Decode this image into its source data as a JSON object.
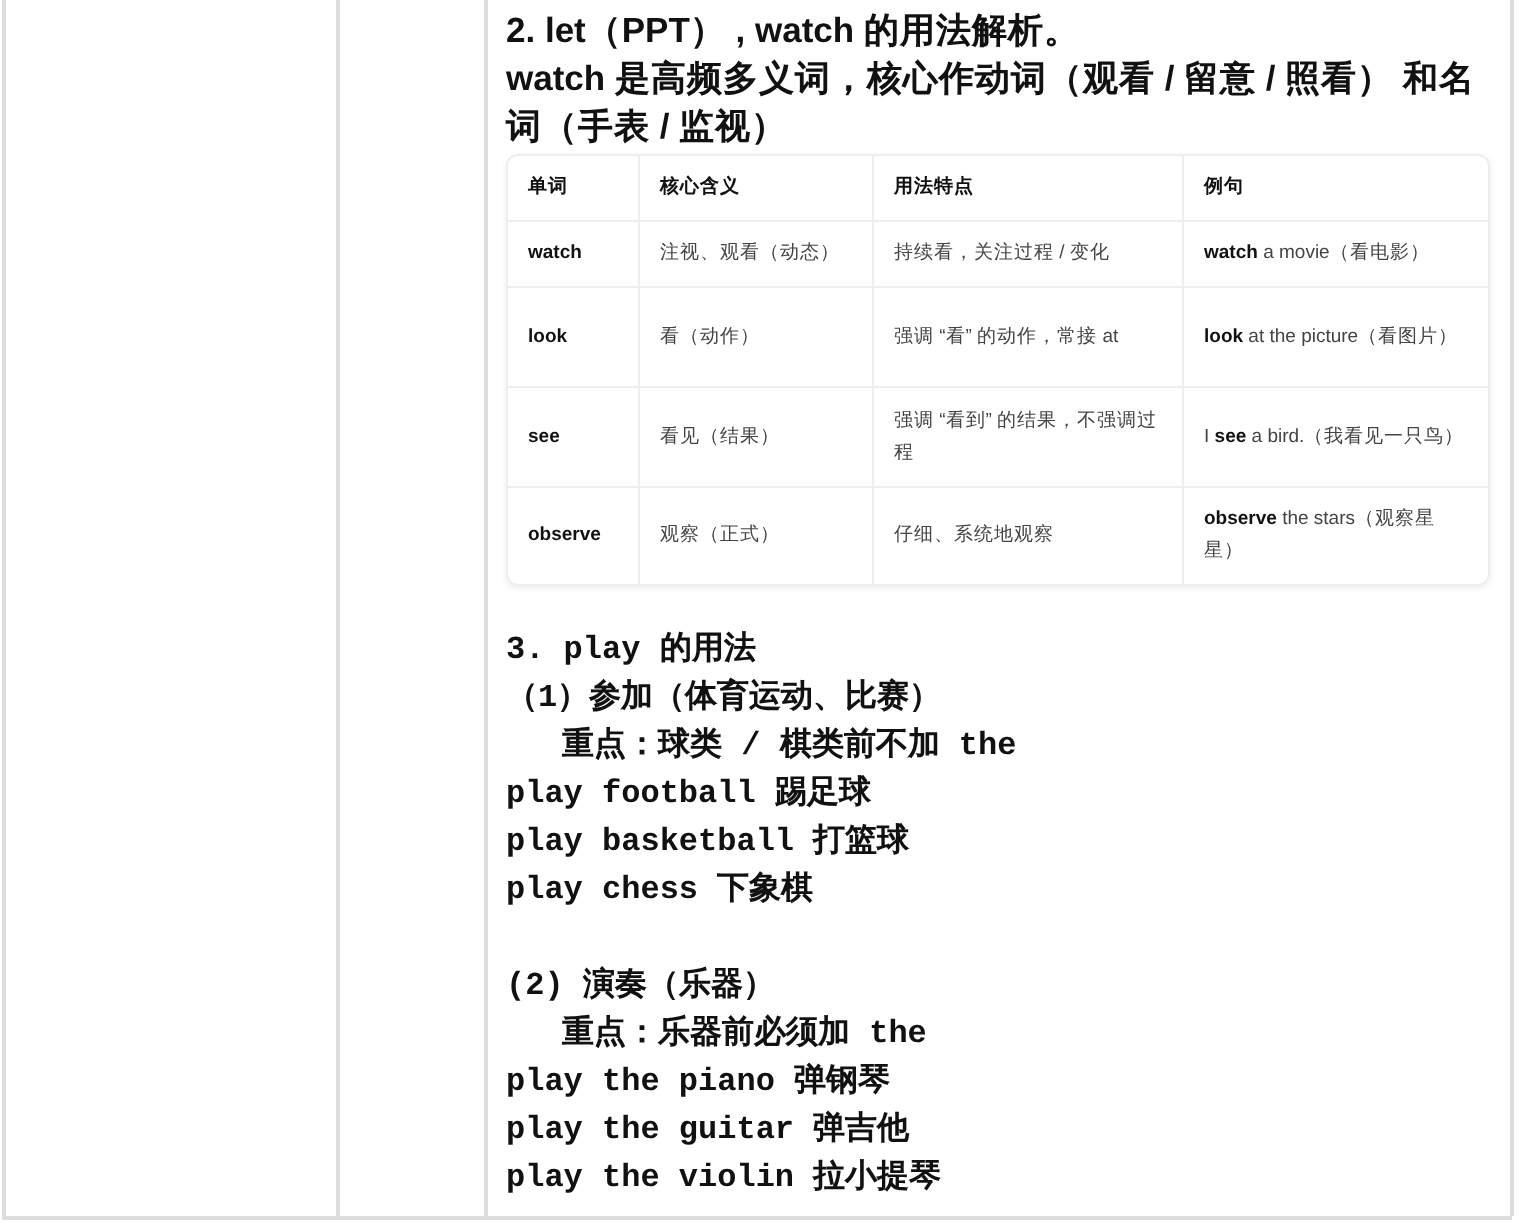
{
  "heading": [
    "2. let（PPT） , watch 的用法解析。",
    "watch 是高频多义词，核心作动词（观看 / 留意 / 照看） 和名词（手表 / 监视）"
  ],
  "table": {
    "columns": [
      "单词",
      "核心含义",
      "用法特点",
      "例句"
    ],
    "rows": [
      [
        "watch",
        "注视、观看（动态）",
        "持续看，关注过程 / 变化",
        "**watch** a movie（看电影）"
      ],
      [
        "look",
        "看（动作）",
        "强调 “看” 的动作，常接 at",
        "**look** at the picture（看图片）"
      ],
      [
        "see",
        "看见（结果）",
        "强调 “看到” 的结果，不强调过程",
        "I **see** a bird.（我看见一只鸟）"
      ],
      [
        "observe",
        "观察（正式）",
        "仔细、系统地观察",
        "**observe** the stars（观察星星）"
      ]
    ]
  },
  "play_section": {
    "title": "3. play 的用法",
    "groups": [
      {
        "label": "（1）参加（体育运动、比赛）",
        "note": "重点：球类 / 棋类前不加 the",
        "examples": [
          "play football 踢足球",
          "play basketball 打篮球",
          "play chess 下象棋"
        ]
      },
      {
        "label": "(2) 演奏（乐器）",
        "note": "重点：乐器前必须加 the",
        "examples": [
          "play the piano 弹钢琴",
          "play the guitar 弹吉他",
          "play the violin 拉小提琴"
        ]
      }
    ]
  }
}
